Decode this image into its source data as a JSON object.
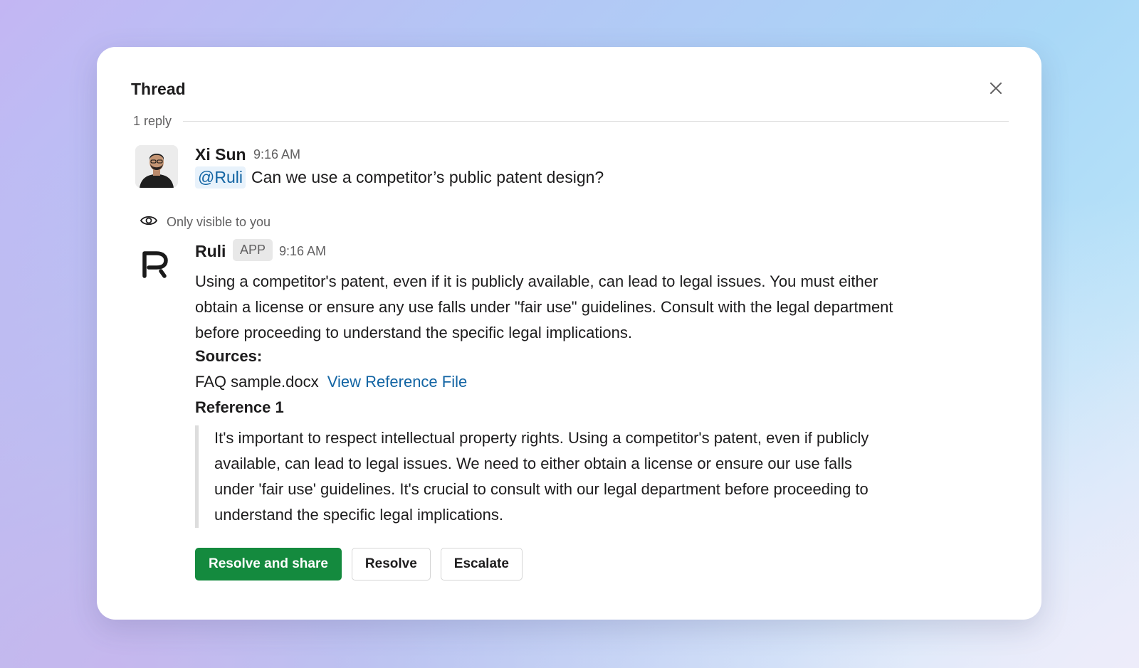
{
  "thread": {
    "title": "Thread",
    "reply_count": "1 reply"
  },
  "message_user": {
    "sender": "Xi Sun",
    "time": "9:16 AM",
    "mention": "@Ruli",
    "text": "Can we use a competitor’s public patent design?"
  },
  "visibility_note": "Only visible to you",
  "message_app": {
    "sender": "Ruli",
    "badge": "APP",
    "time": "9:16 AM",
    "answer": "Using a competitor's patent, even if it is publicly available, can lead to legal issues. You must either obtain a license or ensure any use falls under \"fair use\" guidelines. Consult with the legal department before proceeding to understand the specific legal implications.",
    "sources_label": "Sources:",
    "source_file": "FAQ sample.docx",
    "source_link": "View Reference File",
    "reference_label": "Reference 1",
    "reference_text": "It's important to respect intellectual property rights. Using a competitor's patent, even if publicly available, can lead to legal issues. We need to either obtain a license or ensure our use falls under 'fair use' guidelines. It's crucial to consult with our legal department before proceeding to understand the specific legal implications."
  },
  "actions": {
    "resolve_share": "Resolve and share",
    "resolve": "Resolve",
    "escalate": "Escalate"
  },
  "colors": {
    "primary_button": "#148a3e",
    "link": "#1264a3",
    "text": "#1d1c1d",
    "muted": "#616061"
  },
  "icons": {
    "close": "close-icon",
    "visibility": "eye-icon",
    "app_logo": "ruli-logo-icon"
  }
}
